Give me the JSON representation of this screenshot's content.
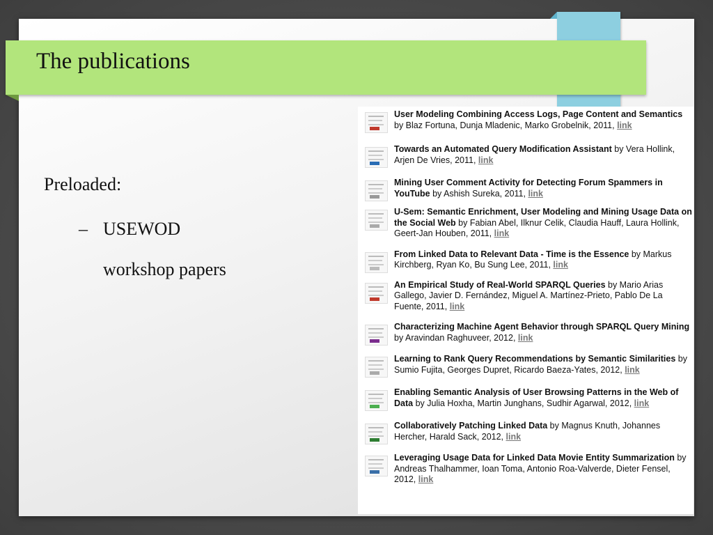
{
  "slide": {
    "title": "The publications",
    "bullet_level1": "Preloaded:",
    "bullet_dash": "–",
    "bullet_level2_line1": "USEWOD",
    "bullet_level2_line2": "workshop papers"
  },
  "publications": [
    {
      "title": "User Modeling Combining Access Logs, Page Content and Semantics",
      "rest": " by Blaz Fortuna, Dunja Mladenic, Marko Grobelnik, 2011, ",
      "link": "link",
      "thumb_color": "#c0392b"
    },
    {
      "title": "Towards an Automated Query Modification Assistant",
      "rest": " by Vera Hollink, Arjen De Vries, 2011, ",
      "link": "link",
      "thumb_color": "#2a6db5"
    },
    {
      "title": "Mining User Comment Activity for Detecting Forum Spammers in YouTube",
      "rest": " by Ashish Sureka, 2011, ",
      "link": "link",
      "thumb_color": "#999999"
    },
    {
      "title": "U-Sem: Semantic Enrichment, User Modeling and Mining Usage Data on the Social Web",
      "rest": " by Fabian Abel, Ilknur Celik, Claudia Hauff, Laura Hollink, Geert-Jan Houben, 2011, ",
      "link": "link",
      "thumb_color": "#aaaaaa"
    },
    {
      "title": "From Linked Data to Relevant Data - Time is the Essence",
      "rest": " by Markus Kirchberg, Ryan Ko, Bu Sung Lee, 2011, ",
      "link": "link",
      "thumb_color": "#bbbbbb"
    },
    {
      "title": "An Empirical Study of Real-World SPARQL Queries",
      "rest": " by Mario Arias Gallego, Javier D. Fernández, Miguel A. Martínez-Prieto, Pablo De La Fuente, 2011, ",
      "link": "link",
      "thumb_color": "#c0392b"
    },
    {
      "title": "Characterizing Machine Agent Behavior through SPARQL Query Mining",
      "rest": " by Aravindan Raghuveer, 2012, ",
      "link": "link",
      "thumb_color": "#7b2d8e"
    },
    {
      "title": "Learning to Rank Query Recommendations by Semantic Similarities",
      "rest": " by Sumio Fujita, Georges Dupret, Ricardo Baeza-Yates, 2012, ",
      "link": "link",
      "thumb_color": "#aaaaaa"
    },
    {
      "title": "Enabling Semantic Analysis of User Browsing Patterns in the Web of Data",
      "rest": " by Julia Hoxha, Martin Junghans, Sudhir Agarwal, 2012, ",
      "link": "link",
      "thumb_color": "#4caf50"
    },
    {
      "title": "Collaboratively Patching Linked Data",
      "rest": " by Magnus Knuth, Johannes Hercher, Harald Sack, 2012, ",
      "link": "link",
      "thumb_color": "#2e7d32"
    },
    {
      "title": "Leveraging Usage Data for Linked Data Movie Entity Summarization",
      "rest": " by Andreas Thalhammer, Ioan Toma, Antonio Roa-Valverde, Dieter Fensel, 2012, ",
      "link": "link",
      "thumb_color": "#3a6fa8"
    }
  ]
}
